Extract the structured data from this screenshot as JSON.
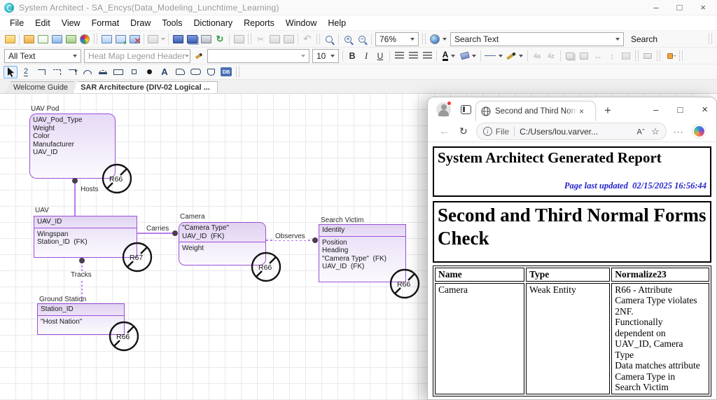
{
  "sa": {
    "titlebar": {
      "title": "System Architect - SA_Encys(Data_Modeling_Lunchtime_Learning)"
    },
    "menu": [
      "File",
      "Edit",
      "View",
      "Format",
      "Draw",
      "Tools",
      "Dictionary",
      "Reports",
      "Window",
      "Help"
    ],
    "toolbar": {
      "zoom_level": "76%",
      "search_text": "Search Text",
      "search_button": "Search"
    },
    "format": {
      "text_style": "All Text",
      "named_style": "Heat Map Legend Header",
      "font_size": "10",
      "bold": "B",
      "italic": "I",
      "underline": "U"
    },
    "tools": {
      "two": "2",
      "text": "A",
      "db": "DB"
    },
    "tabs": {
      "welcome": "Welcome Guide",
      "active": "SAR Architecture (DIV-02 Logical ..."
    }
  },
  "diagram": {
    "entities": {
      "uav_pod": {
        "title": "UAV Pod",
        "attrs": [
          "UAV_Pod_Type",
          "Weight",
          "Color",
          "Manufacturer",
          "UAV_ID"
        ]
      },
      "uav": {
        "title": "UAV",
        "key": "UAV_ID",
        "attrs": [
          "Wingspan",
          "Station_ID  (FK)"
        ]
      },
      "camera": {
        "title": "Camera",
        "keys": [
          "\"Camera Type\"",
          "UAV_ID  (FK)"
        ],
        "attrs": [
          "Weight"
        ]
      },
      "search_victim": {
        "title": "Search Victim",
        "key": "Identity",
        "attrs": [
          "Position",
          "Heading",
          "\"Camera Type\"  (FK)",
          "UAV_ID  (FK)"
        ]
      },
      "ground_station": {
        "title": "Ground Station",
        "key": "Station_ID",
        "attrs": [
          "\"Host Nation\""
        ]
      }
    },
    "relationships": {
      "hosts": "Hosts",
      "carries": "Carries",
      "tracks": "Tracks",
      "observes": "Observes"
    },
    "rules": {
      "pod": "R66",
      "uav": "R67",
      "camera": "R66",
      "victim": "R66",
      "ground": "R66"
    }
  },
  "browser": {
    "tab_title": "Second and Third Normal",
    "address": {
      "scheme": "File",
      "url": "C:/Users/lou.varver..."
    },
    "report": {
      "title": "System Architect Generated Report",
      "updated": "Page last updated  02/15/2025 16:56:44",
      "heading": "Second and Third Normal Forms Check",
      "table": {
        "headers": [
          "Name",
          "Type",
          "Normalize23"
        ],
        "row": {
          "name": "Camera",
          "type": "Weak Entity",
          "normalize": "R66 - Attribute\nCamera Type violates\n2NF.\nFunctionally\ndependent on\nUAV_ID, Camera\nType\nData matches attribute\nCamera Type in\nSearch Victim"
        }
      }
    }
  },
  "colors": {
    "entity_border": "#9c4fd8",
    "relationship_line": "#a052e0",
    "report_blue": "#2222cc"
  }
}
